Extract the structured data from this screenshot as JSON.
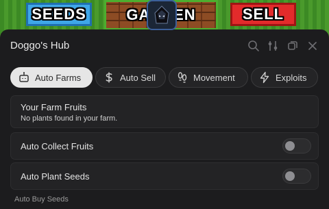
{
  "game": {
    "seeds_label": "SEEDS",
    "garden_label": "GARDEN",
    "sell_label": "SELL"
  },
  "window": {
    "title": "Doggo's Hub"
  },
  "tabs": [
    {
      "label": "Auto Farms",
      "icon": "robot-icon",
      "active": true
    },
    {
      "label": "Auto Sell",
      "icon": "dollar-icon",
      "active": false
    },
    {
      "label": "Movement",
      "icon": "footprints-icon",
      "active": false
    },
    {
      "label": "Exploits",
      "icon": "lightning-icon",
      "active": false
    }
  ],
  "farm_info": {
    "title": "Your Farm Fruits",
    "subtitle": "No plants found in your farm."
  },
  "toggles": [
    {
      "label": "Auto Collect Fruits",
      "on": false
    },
    {
      "label": "Auto Plant Seeds",
      "on": false
    }
  ],
  "section": {
    "label": "Auto Buy Seeds"
  },
  "colors": {
    "window_bg": "#1c1c1e",
    "card_bg": "#232325",
    "active_tab": "#e6e6e6"
  }
}
